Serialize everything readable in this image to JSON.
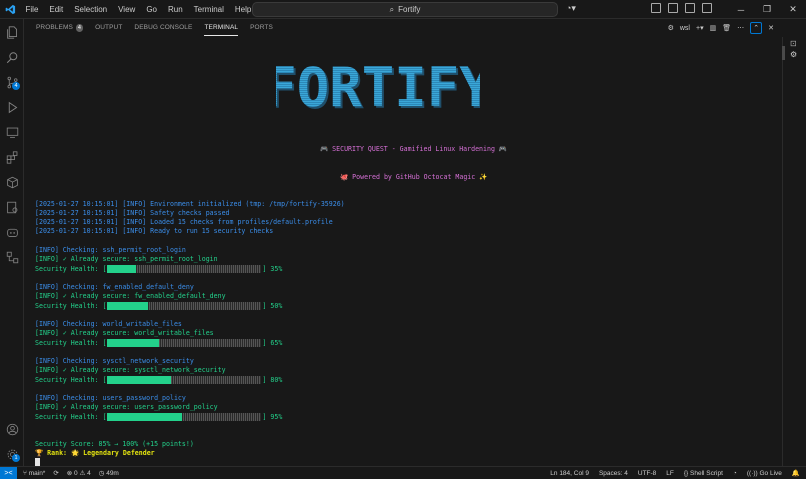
{
  "menu": [
    "File",
    "Edit",
    "Selection",
    "View",
    "Go",
    "Run",
    "Terminal",
    "Help"
  ],
  "search": {
    "text": "Fortify"
  },
  "panel": {
    "tabs": [
      {
        "label": "PROBLEMS",
        "badge": "4"
      },
      {
        "label": "OUTPUT"
      },
      {
        "label": "DEBUG CONSOLE"
      },
      {
        "label": "TERMINAL",
        "active": true
      },
      {
        "label": "PORTS"
      }
    ],
    "shell_label": "wsl"
  },
  "activity_badges": {
    "scm": "4",
    "accounts": "1"
  },
  "terminal": {
    "banner_title": "FORTIFY",
    "subtitle": "🎮 SECURITY QUEST - Gamified Linux Hardening 🎮",
    "powered": "🐙 Powered by GitHub Octocat Magic ✨",
    "init_lines": [
      "[2025-01-27 10:15:01] [INFO] Environment initialized (tmp: /tmp/fortify-35926)",
      "[2025-01-27 10:15:01] [INFO] Safety checks passed",
      "[2025-01-27 10:15:01] [INFO] Loaded 15 checks from profiles/default.profile",
      "[2025-01-27 10:15:01] [INFO] Ready to run 15 security checks"
    ],
    "health_label": "Security Health: [",
    "checks": [
      {
        "checking": "[INFO] Checking: ssh_permit_root_login",
        "secure": "[INFO] ✓ Already secure: ssh_permit_root_login",
        "percent": 35,
        "percent_label": "] 35%"
      },
      {
        "checking": "[INFO] Checking: fw_enabled_default_deny",
        "secure": "[INFO] ✓ Already secure: fw_enabled_default_deny",
        "percent": 50,
        "percent_label": "] 50%"
      },
      {
        "checking": "[INFO] Checking: world_writable_files",
        "secure": "[INFO] ✓ Already secure: world_writable_files",
        "percent": 65,
        "percent_label": "] 65%"
      },
      {
        "checking": "[INFO] Checking: sysctl_network_security",
        "secure": "[INFO] ✓ Already secure: sysctl_network_security",
        "percent": 80,
        "percent_label": "] 80%"
      },
      {
        "checking": "[INFO] Checking: users_password_policy",
        "secure": "[INFO] ✓ Already secure: users_password_policy",
        "percent": 95,
        "percent_label": "] 95%"
      }
    ],
    "score": "Security Score: 85% → 100% (+15 points!)",
    "rank": "🏆 Rank: 🌟 Legendary Defender",
    "colors": {
      "blue": "#3b8eea",
      "green": "#23d18b",
      "magenta": "#d670d6",
      "yellow": "#e5e510"
    }
  },
  "statusbar": {
    "branch": "main*",
    "problems": "⊗ 0 ⚠ 4",
    "time": "49m",
    "position": "Ln 184, Col 9",
    "spaces": "Spaces: 4",
    "encoding": "UTF-8",
    "eol": "LF",
    "language": "Shell Script",
    "golive": "Go Live"
  }
}
